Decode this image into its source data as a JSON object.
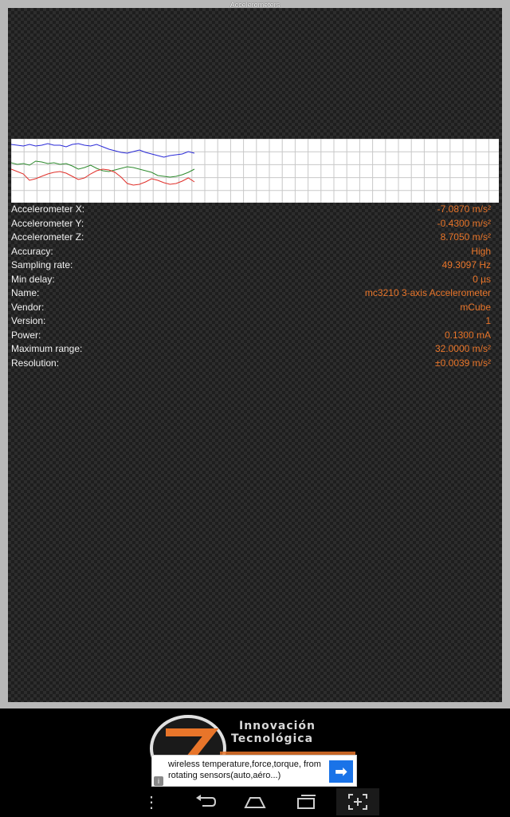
{
  "app": {
    "title": "Accelerometers"
  },
  "chart_data": {
    "type": "line",
    "series": [
      {
        "values": [
          7,
          8,
          9,
          7,
          9,
          8,
          6,
          8,
          8,
          10,
          7,
          6,
          8,
          9,
          7,
          10,
          13,
          15,
          17,
          18,
          16,
          14,
          17,
          19,
          21,
          23,
          21,
          20,
          19,
          16,
          18
        ]
      },
      {
        "values": [
          30,
          32,
          31,
          33,
          28,
          29,
          31,
          30,
          32,
          31,
          34,
          38,
          36,
          33,
          37,
          40,
          41,
          39,
          37,
          35,
          36,
          38,
          40,
          42,
          46,
          47,
          48,
          47,
          45,
          42,
          38
        ]
      },
      {
        "values": [
          38,
          41,
          44,
          52,
          50,
          47,
          44,
          42,
          41,
          43,
          47,
          51,
          49,
          44,
          40,
          38,
          39,
          42,
          48,
          56,
          58,
          57,
          54,
          50,
          52,
          55,
          57,
          56,
          53,
          49,
          54
        ]
      }
    ],
    "colors": [
      "#2a2ad8",
      "#2e8b2e",
      "#e0302a"
    ],
    "grid": true
  },
  "readings": [
    {
      "label": "Accelerometer X:",
      "value": "-7.0870 m/s²"
    },
    {
      "label": "Accelerometer Y:",
      "value": "-0.4300 m/s²"
    },
    {
      "label": "Accelerometer Z:",
      "value": "8.7050 m/s²"
    },
    {
      "label": "Accuracy:",
      "value": "High"
    },
    {
      "label": "Sampling rate:",
      "value": "49.3097 Hz"
    },
    {
      "label": "Min delay:",
      "value": "0 µs"
    },
    {
      "label": "Name:",
      "value": "mc3210 3-axis Accelerometer"
    },
    {
      "label": "Vendor:",
      "value": "mCube"
    },
    {
      "label": "Version:",
      "value": "1"
    },
    {
      "label": "Power:",
      "value": "0.1300 mA"
    },
    {
      "label": "Maximum range:",
      "value": "32.0000 m/s²"
    },
    {
      "label": "Resolution:",
      "value": "±0.0039 m/s²"
    }
  ],
  "ad": {
    "logo_line1": "Innovación",
    "logo_line2": "Tecnológica",
    "text": "wireless temperature,force,torque, from rotating sensors(auto,aéro...)",
    "info_icon": "info-icon",
    "arrow_icon": "arrow-right-icon"
  },
  "nav": {
    "menu_icon": "menu-dots-icon",
    "back_icon": "back-icon",
    "home_icon": "home-icon",
    "recent_icon": "recent-apps-icon",
    "screenshot_icon": "screenshot-icon"
  },
  "colors": {
    "value_text": "#e8752a",
    "label_text": "#f2f2f2",
    "ad_button": "#1a73e8"
  }
}
